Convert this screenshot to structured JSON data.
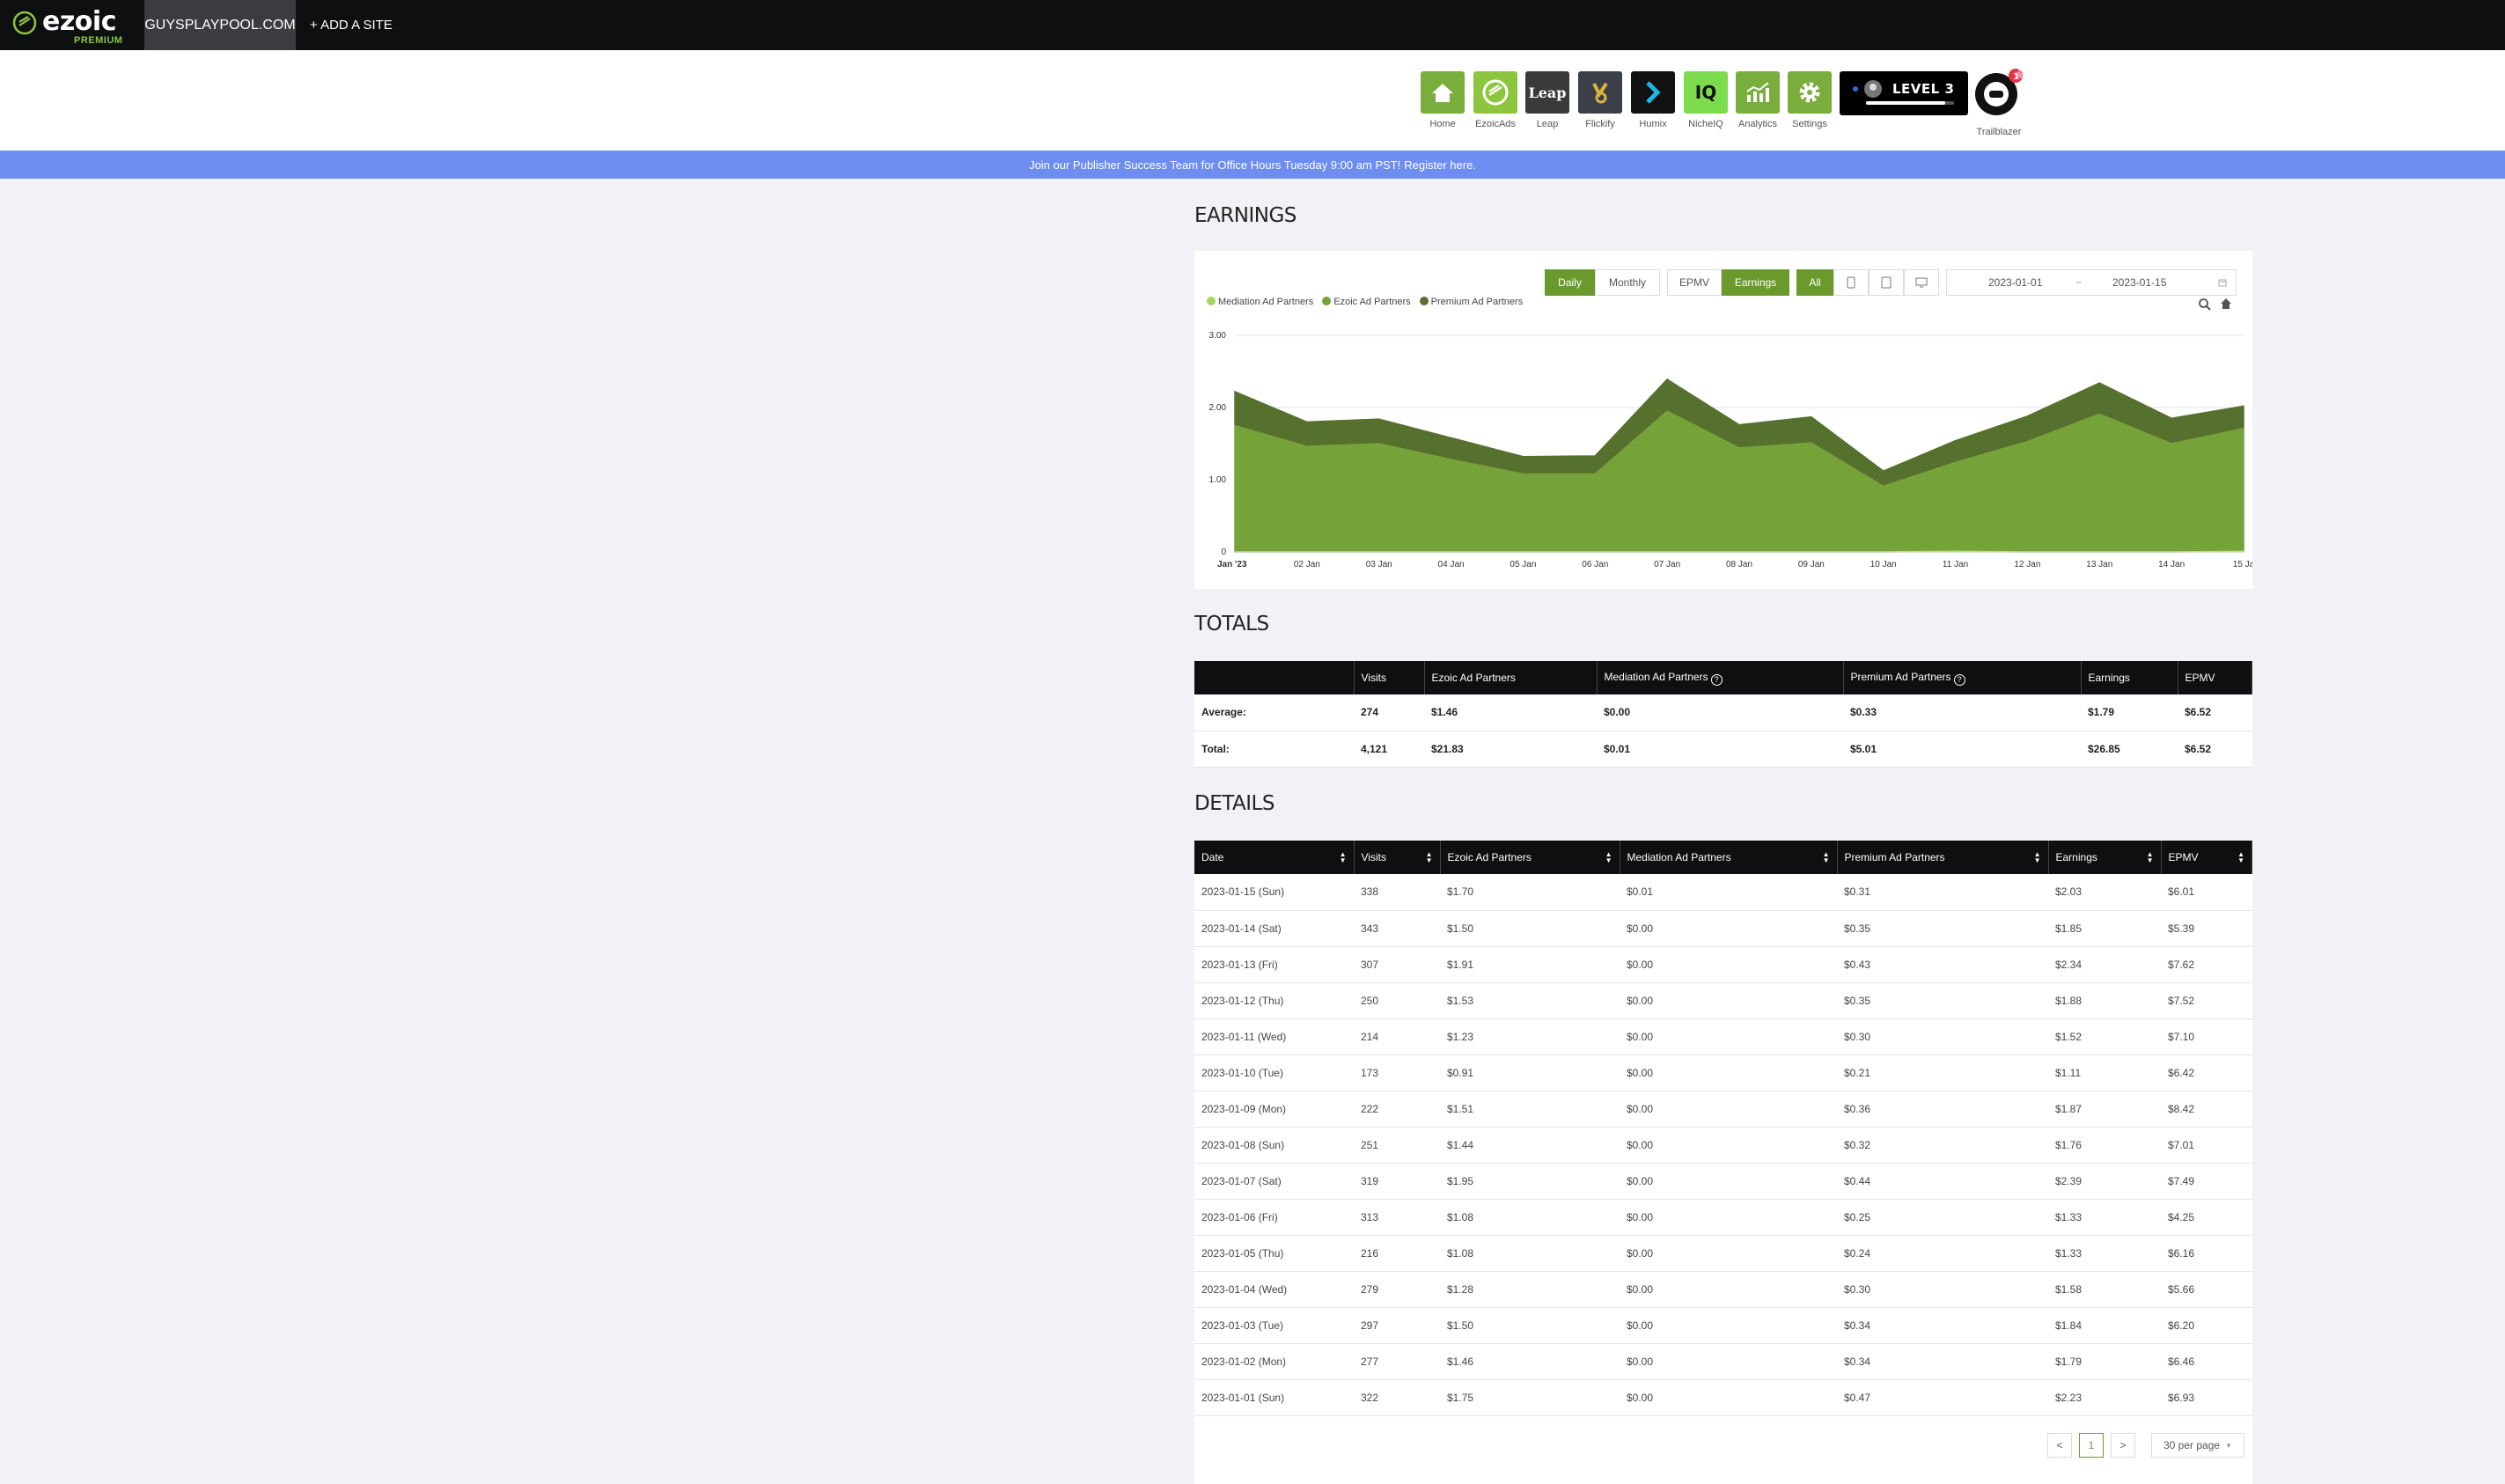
{
  "topbar": {
    "logo_word": "ezoic",
    "logo_sub": "PREMIUM",
    "site_tab": "GUYSPLAYPOOL.COM",
    "add_site": "+ ADD A SITE"
  },
  "apps": [
    {
      "label": "Home",
      "icon": "home-icon",
      "color": "#79ad3c"
    },
    {
      "label": "EzoicAds",
      "icon": "ezoicads-icon",
      "color": "#8cc63f"
    },
    {
      "label": "Leap",
      "icon": "leap-icon",
      "color": "#3a3a3a",
      "text": "Leap"
    },
    {
      "label": "Flickify",
      "icon": "flickify-icon",
      "color": "#3a3f48"
    },
    {
      "label": "Humix",
      "icon": "humix-icon",
      "color": "#111111"
    },
    {
      "label": "NicheIQ",
      "icon": "nicheiq-icon",
      "color": "#7ddc4d",
      "text": "IQ"
    },
    {
      "label": "Analytics",
      "icon": "analytics-icon",
      "color": "#79ad3c"
    },
    {
      "label": "Settings",
      "icon": "settings-icon",
      "color": "#79ad3c"
    }
  ],
  "level": {
    "text": "LEVEL 3",
    "progress": 0.9
  },
  "trailblazer": {
    "label": "Trailblazer",
    "badge": "1"
  },
  "banner": {
    "text": "Join our Publisher Success Team for Office Hours Tuesday 9:00 am PST!",
    "link": "Register here."
  },
  "earnings_title": "EARNINGS",
  "controls": {
    "daily": "Daily",
    "monthly": "Monthly",
    "epmv": "EPMV",
    "earnings": "Earnings",
    "all": "All",
    "date_from": "2023-01-01",
    "date_sep": "~",
    "date_to": "2023-01-15"
  },
  "chart_data": {
    "type": "area",
    "stacked": true,
    "x": [
      "Jan '23",
      "02 Jan",
      "03 Jan",
      "04 Jan",
      "05 Jan",
      "06 Jan",
      "07 Jan",
      "08 Jan",
      "09 Jan",
      "10 Jan",
      "11 Jan",
      "12 Jan",
      "13 Jan",
      "14 Jan",
      "15 Ja"
    ],
    "series": [
      {
        "name": "Mediation Ad Partners",
        "color": "#a4d65e",
        "values": [
          0.0,
          0.0,
          0.0,
          0.0,
          0.0,
          0.0,
          0.0,
          0.0,
          0.0,
          0.0,
          0.01,
          0.0,
          0.0,
          0.0,
          0.01
        ]
      },
      {
        "name": "Ezoic Ad Partners",
        "color": "#76a23a",
        "values": [
          1.75,
          1.46,
          1.5,
          1.28,
          1.08,
          1.08,
          1.95,
          1.44,
          1.51,
          0.91,
          1.23,
          1.53,
          1.91,
          1.5,
          1.7
        ]
      },
      {
        "name": "Premium Ad Partners",
        "color": "#56702e",
        "values": [
          0.47,
          0.34,
          0.34,
          0.3,
          0.24,
          0.25,
          0.44,
          0.32,
          0.36,
          0.21,
          0.3,
          0.35,
          0.43,
          0.35,
          0.31
        ]
      }
    ],
    "yticks": [
      "0",
      "1.00",
      "2.00",
      "3.00"
    ],
    "ylim": [
      0,
      3
    ],
    "grid": true,
    "legend": "top-left"
  },
  "totals_title": "TOTALS",
  "totals": {
    "headers": [
      "",
      "Visits",
      "Ezoic Ad Partners",
      "Mediation Ad Partners",
      "Premium Ad Partners",
      "Earnings",
      "EPMV"
    ],
    "rows": [
      [
        "Average:",
        "274",
        "$1.46",
        "$0.00",
        "$0.33",
        "$1.79",
        "$6.52"
      ],
      [
        "Total:",
        "4,121",
        "$21.83",
        "$0.01",
        "$5.01",
        "$26.85",
        "$6.52"
      ]
    ]
  },
  "details_title": "DETAILS",
  "details": {
    "headers": [
      "Date",
      "Visits",
      "Ezoic Ad Partners",
      "Mediation Ad Partners",
      "Premium Ad Partners",
      "Earnings",
      "EPMV"
    ],
    "rows": [
      [
        "2023-01-15 (Sun)",
        "338",
        "$1.70",
        "$0.01",
        "$0.31",
        "$2.03",
        "$6.01"
      ],
      [
        "2023-01-14 (Sat)",
        "343",
        "$1.50",
        "$0.00",
        "$0.35",
        "$1.85",
        "$5.39"
      ],
      [
        "2023-01-13 (Fri)",
        "307",
        "$1.91",
        "$0.00",
        "$0.43",
        "$2.34",
        "$7.62"
      ],
      [
        "2023-01-12 (Thu)",
        "250",
        "$1.53",
        "$0.00",
        "$0.35",
        "$1.88",
        "$7.52"
      ],
      [
        "2023-01-11 (Wed)",
        "214",
        "$1.23",
        "$0.00",
        "$0.30",
        "$1.52",
        "$7.10"
      ],
      [
        "2023-01-10 (Tue)",
        "173",
        "$0.91",
        "$0.00",
        "$0.21",
        "$1.11",
        "$6.42"
      ],
      [
        "2023-01-09 (Mon)",
        "222",
        "$1.51",
        "$0.00",
        "$0.36",
        "$1.87",
        "$8.42"
      ],
      [
        "2023-01-08 (Sun)",
        "251",
        "$1.44",
        "$0.00",
        "$0.32",
        "$1.76",
        "$7.01"
      ],
      [
        "2023-01-07 (Sat)",
        "319",
        "$1.95",
        "$0.00",
        "$0.44",
        "$2.39",
        "$7.49"
      ],
      [
        "2023-01-06 (Fri)",
        "313",
        "$1.08",
        "$0.00",
        "$0.25",
        "$1.33",
        "$4.25"
      ],
      [
        "2023-01-05 (Thu)",
        "216",
        "$1.08",
        "$0.00",
        "$0.24",
        "$1.33",
        "$6.16"
      ],
      [
        "2023-01-04 (Wed)",
        "279",
        "$1.28",
        "$0.00",
        "$0.30",
        "$1.58",
        "$5.66"
      ],
      [
        "2023-01-03 (Tue)",
        "297",
        "$1.50",
        "$0.00",
        "$0.34",
        "$1.84",
        "$6.20"
      ],
      [
        "2023-01-02 (Mon)",
        "277",
        "$1.46",
        "$0.00",
        "$0.34",
        "$1.79",
        "$6.46"
      ],
      [
        "2023-01-01 (Sun)",
        "322",
        "$1.75",
        "$0.00",
        "$0.47",
        "$2.23",
        "$6.93"
      ]
    ]
  },
  "pagination": {
    "prev": "<",
    "page": "1",
    "next": ">",
    "per_page": "30 per page"
  }
}
